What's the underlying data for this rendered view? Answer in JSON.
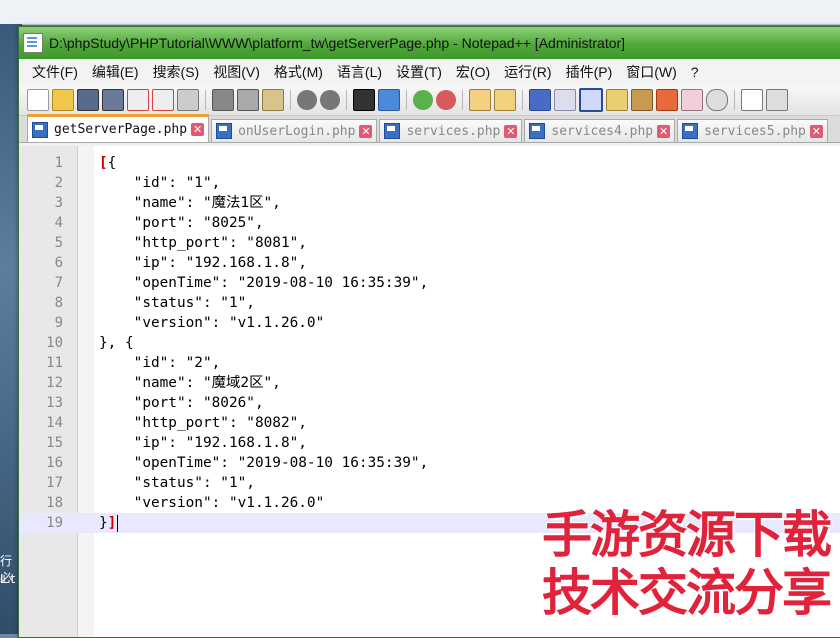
{
  "window": {
    "title": "D:\\phpStudy\\PHPTutorial\\WWW\\platform_tw\\getServerPage.php - Notepad++ [Administrator]"
  },
  "menu": [
    "文件(F)",
    "编辑(E)",
    "搜索(S)",
    "视图(V)",
    "格式(M)",
    "语言(L)",
    "设置(T)",
    "宏(O)",
    "运行(R)",
    "插件(P)",
    "窗口(W)",
    "?"
  ],
  "tabs": [
    {
      "label": "getServerPage.php",
      "active": true
    },
    {
      "label": "onUserLogin.php",
      "active": false
    },
    {
      "label": "services.php",
      "active": false
    },
    {
      "label": "services4.php",
      "active": false
    },
    {
      "label": "services5.php",
      "active": false
    }
  ],
  "editor": {
    "current_line": 19,
    "lines": [
      "[{",
      "    \"id\": \"1\",",
      "    \"name\": \"魔法1区\",",
      "    \"port\": \"8025\",",
      "    \"http_port\": \"8081\",",
      "    \"ip\": \"192.168.1.8\",",
      "    \"openTime\": \"2019-08-10 16:35:39\",",
      "    \"status\": \"1\",",
      "    \"version\": \"v1.1.26.0\"",
      "}, {",
      "    \"id\": \"2\",",
      "    \"name\": \"魔域2区\",",
      "    \"port\": \"8026\",",
      "    \"http_port\": \"8082\",",
      "    \"ip\": \"192.168.1.8\",",
      "    \"openTime\": \"2019-08-10 16:35:39\",",
      "    \"status\": \"1\",",
      "    \"version\": \"v1.1.26.0\"",
      "}]"
    ]
  },
  "watermark": {
    "line1": "手游资源下载",
    "line2": "技术交流分享"
  },
  "background": {
    "left_text": [
      "行必",
      "L.t"
    ]
  },
  "colors": {
    "titlebar": "#4fa83a",
    "active_tab_accent": "#f0a030",
    "current_line": "#e8e8ff",
    "watermark": "#e0223a"
  }
}
